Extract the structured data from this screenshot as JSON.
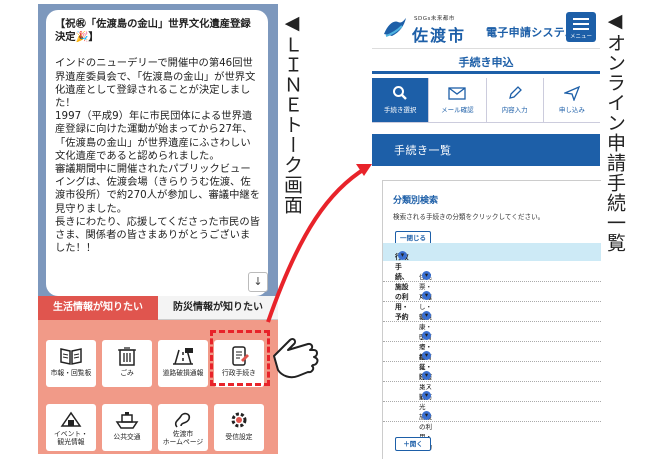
{
  "line_screen": {
    "message_paragraphs": [
      "【祝㊗「佐渡島の金山」世界文化遺産登録決定🎉】",
      "インドのニューデリーで開催中の第46回世界遺産委員会で、「佐渡島の金山」が世界文化遺産として登録されることが決定しました！\n1997（平成9）年に市民団体による世界遺産登録に向けた運動が始まってから27年、「佐渡島の金山」が世界遺産にふさわしい文化遺産であると認められました。\n審議期間中に開催されたパブリックビューイングは、佐渡会場（きらりうむ佐渡、佐渡市役所）で約270人が参加し、審議中継を見守りました。\n長きにわたり、応援してくださった市民の皆さま、関係者の皆さまありがとうございました！！"
    ],
    "scroll_down": "↓",
    "tabs": [
      {
        "label": "生活情報が知りたい",
        "active": true
      },
      {
        "label": "防災情報が知りたい",
        "active": false
      }
    ],
    "tiles": [
      {
        "label": "市報・回覧板",
        "icon": "book-icon"
      },
      {
        "label": "ごみ",
        "icon": "trash-icon"
      },
      {
        "label": "道路破損通報",
        "icon": "road-icon"
      },
      {
        "label": "行政手続き",
        "icon": "phone-form-icon"
      },
      {
        "label": "イベント・\n観光情報",
        "icon": "event-icon"
      },
      {
        "label": "公共交通",
        "icon": "ship-icon"
      },
      {
        "label": "佐渡市\nホームページ",
        "icon": "home-icon"
      },
      {
        "label": "受信設定",
        "icon": "gear-icon"
      }
    ]
  },
  "labels": {
    "left": "◀ＬＩＮＥトーク画面",
    "right": "◀オンライン申請手続一覧"
  },
  "site": {
    "logo_sub": "SDGs未来都市",
    "city_name": "佐渡市",
    "system_title": "電子申請システム",
    "menu_label": "メニュー",
    "page_title": "手続き申込",
    "steps": [
      {
        "label": "手続き選択",
        "icon": "search-icon",
        "active": true
      },
      {
        "label": "メール確認",
        "icon": "mail-icon",
        "active": false
      },
      {
        "label": "内容入力",
        "icon": "pencil-icon",
        "active": false
      },
      {
        "label": "申し込み",
        "icon": "send-icon",
        "active": false
      }
    ],
    "section_title": "手続き一覧",
    "panel_title": "分類別検索",
    "panel_desc": "検索される手続きの分類をクリックしてください。",
    "close_label": "一閉じる",
    "category_heading": "行政手続、施設の利用・予約",
    "categories": [
      "住民票・戸籍",
      "くらし・環境",
      "健康・医療・福祉・介護",
      "子育て・教育",
      "産業・ビジネス",
      "防災・消防",
      "観光",
      "施設の利用・予約"
    ],
    "open_label": "＋開く"
  },
  "colors": {
    "line_bg": "#7d98bd",
    "menu_bg": "#f19a88",
    "accent_red": "#e8232a",
    "site_blue": "#1d5fa8",
    "category_bg": "#cdeaf6"
  }
}
